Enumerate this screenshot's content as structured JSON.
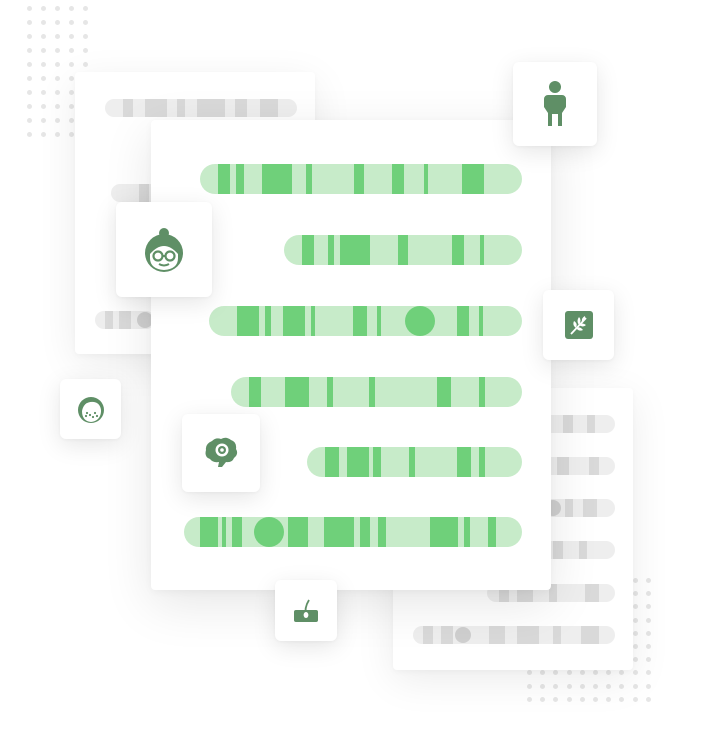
{
  "colors": {
    "accent_green": "#6fd07a",
    "track_green": "#c7ebc9",
    "icon_green": "#5f8f66",
    "placeholder_grey": "#d9d9d9"
  },
  "icons": [
    "person-silhouette-icon",
    "elderly-woman-glasses-icon",
    "grain-wheat-icon",
    "skin-freckles-face-icon",
    "brain-gear-icon",
    "hair-follicle-icon"
  ]
}
